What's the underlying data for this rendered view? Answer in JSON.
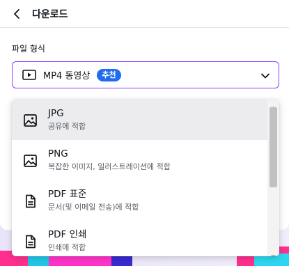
{
  "header": {
    "title": "다운로드",
    "back_icon": "chevron-left-icon"
  },
  "section": {
    "label": "파일 형식"
  },
  "select": {
    "value": "MP4 동영상",
    "badge": "추천",
    "icon": "video-icon",
    "accent_color": "#8b3dff",
    "badge_color": "#1f6cf0"
  },
  "options": [
    {
      "title": "JPG",
      "desc": "공유에 적합",
      "icon": "image-icon"
    },
    {
      "title": "PNG",
      "desc": "복잡한 이미지, 일러스트레이션에 적합",
      "icon": "image-icon"
    },
    {
      "title": "PDF 표준",
      "desc": "문서(및 이메일 전송)에 적합",
      "icon": "document-icon"
    },
    {
      "title": "PDF 인쇄",
      "desc": "인쇄에 적합",
      "icon": "document-icon"
    }
  ]
}
